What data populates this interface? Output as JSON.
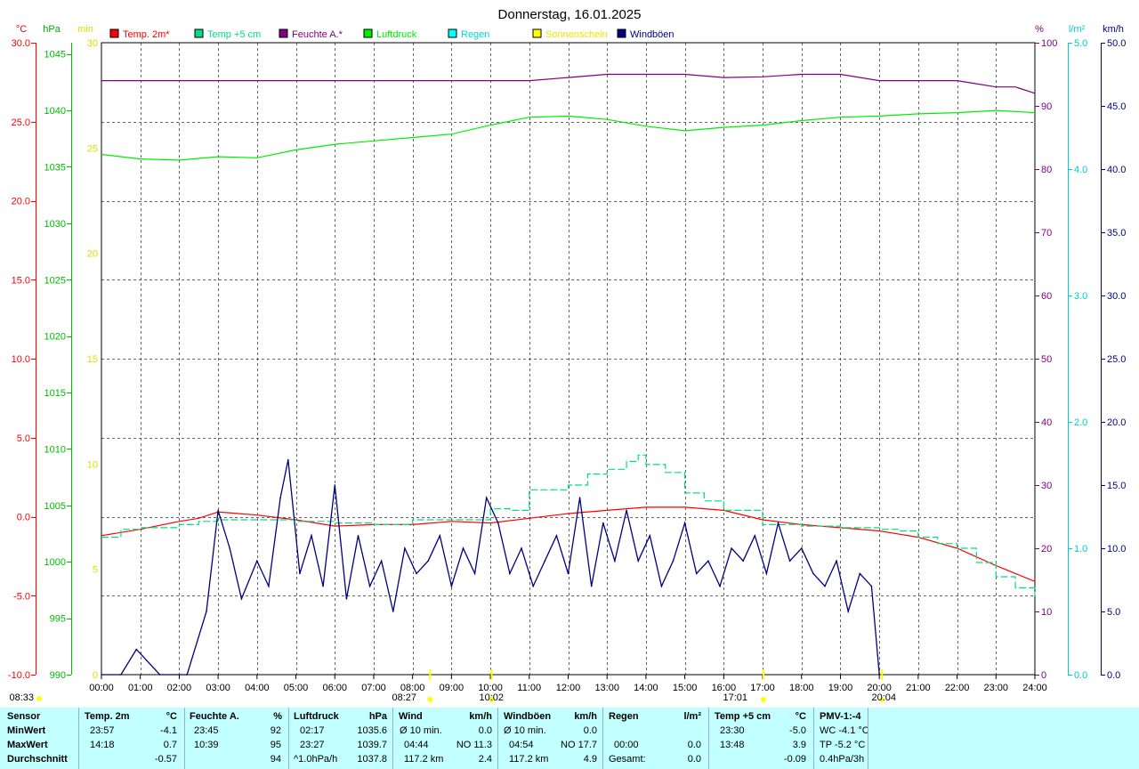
{
  "title": "Donnerstag, 16.01.2025",
  "colors": {
    "temp2m": "#ff0000",
    "temp5cm": "#00e080",
    "humidity": "#800080",
    "pressure": "#00ee00",
    "rain": "#00ffff",
    "sunshine": "#ffff00",
    "gusts": "#000080",
    "footer_bg": "#c2ffff"
  },
  "legend": [
    {
      "label": "Temp. 2m*",
      "color": "#ff0000"
    },
    {
      "label": "Temp +5 cm",
      "color": "#00e080"
    },
    {
      "label": "Feuchte A.*",
      "color": "#800080"
    },
    {
      "label": "Luftdruck",
      "color": "#00ee00"
    },
    {
      "label": "Regen",
      "color": "#00ffff"
    },
    {
      "label": "Sonnenschein",
      "color": "#ffff00"
    },
    {
      "label": "Windböen",
      "color": "#000080"
    }
  ],
  "axis_units": {
    "temp": "°C",
    "pressure": "hPa",
    "sun": "min",
    "humidity": "%",
    "rain": "l/m²",
    "wind": "km/h"
  },
  "chart_data": {
    "type": "line",
    "title": "Donnerstag, 16.01.2025",
    "x_ticks": [
      "00:00",
      "01:00",
      "02:00",
      "03:00",
      "04:00",
      "05:00",
      "06:00",
      "07:00",
      "08:00",
      "09:00",
      "10:00",
      "11:00",
      "12:00",
      "13:00",
      "14:00",
      "15:00",
      "16:00",
      "17:00",
      "18:00",
      "19:00",
      "20:00",
      "21:00",
      "22:00",
      "23:00",
      "24:00"
    ],
    "axes": {
      "temp": {
        "unit": "°C",
        "range": [
          -10,
          30
        ],
        "ticks": [
          "30.0",
          "25.0",
          "20.0",
          "15.0",
          "10.0",
          "5.0",
          "0.0",
          "-5.0",
          "-10.0"
        ]
      },
      "pressure": {
        "unit": "hPa",
        "range": [
          990,
          1046
        ],
        "ticks": [
          "1045",
          "1040",
          "1035",
          "1030",
          "1025",
          "1020",
          "1015",
          "1010",
          "1005",
          "1000",
          "995",
          "990"
        ]
      },
      "sunshine": {
        "unit": "min",
        "range": [
          0,
          30
        ],
        "ticks": [
          "30",
          "25",
          "20",
          "15",
          "10",
          "5",
          "0"
        ]
      },
      "humidity": {
        "unit": "%",
        "range": [
          0,
          100
        ],
        "ticks": [
          "100",
          "90",
          "80",
          "70",
          "60",
          "50",
          "40",
          "30",
          "20",
          "10",
          "0"
        ]
      },
      "rain": {
        "unit": "l/m²",
        "range": [
          0,
          5
        ],
        "ticks": [
          "5.0",
          "4.0",
          "3.0",
          "2.0",
          "1.0",
          "0.0"
        ]
      },
      "wind": {
        "unit": "km/h",
        "range": [
          0,
          50
        ],
        "ticks": [
          "50.0",
          "45.0",
          "40.0",
          "35.0",
          "30.0",
          "25.0",
          "20.0",
          "15.0",
          "10.0",
          "5.0",
          "0.0"
        ]
      }
    },
    "grid": true,
    "series": [
      {
        "name": "Temp. 2m*",
        "axis": "temp",
        "x": [
          0,
          1,
          2,
          2.5,
          3,
          4,
          5,
          6,
          7,
          8,
          9,
          10,
          11,
          12,
          13,
          14,
          15,
          15.5,
          16,
          17,
          18,
          19,
          20,
          21,
          22,
          23,
          24
        ],
        "y": [
          -1.2,
          -0.8,
          -0.3,
          -0.1,
          0.3,
          0.1,
          -0.2,
          -0.6,
          -0.5,
          -0.5,
          -0.3,
          -0.4,
          -0.1,
          0.2,
          0.4,
          0.6,
          0.6,
          0.5,
          0.4,
          -0.2,
          -0.5,
          -0.7,
          -0.9,
          -1.3,
          -2.0,
          -3.1,
          -4.1
        ]
      },
      {
        "name": "Temp +5 cm",
        "axis": "temp",
        "x": [
          0,
          0.5,
          1,
          2,
          2.5,
          3,
          4,
          5,
          6,
          7,
          8,
          9,
          10,
          10.5,
          11,
          12,
          12.5,
          13,
          13.5,
          13.8,
          14,
          14.5,
          15,
          15.5,
          16,
          17,
          18,
          19,
          20,
          20.5,
          21,
          21.5,
          22,
          22.5,
          23,
          23.5,
          24
        ],
        "y": [
          -1.3,
          -0.8,
          -0.7,
          -0.5,
          -0.3,
          -0.2,
          -0.2,
          -0.3,
          -0.4,
          -0.5,
          -0.2,
          -0.2,
          0.5,
          0.4,
          1.7,
          2.0,
          2.7,
          3.0,
          3.5,
          3.9,
          3.3,
          2.8,
          1.5,
          1.0,
          0.4,
          -0.5,
          -0.6,
          -0.7,
          -0.8,
          -0.9,
          -1.3,
          -1.7,
          -2.0,
          -2.9,
          -3.8,
          -4.5,
          -5.0
        ]
      },
      {
        "name": "Feuchte A.*",
        "axis": "humidity",
        "x": [
          0,
          11,
          12,
          13,
          14,
          15,
          16,
          17,
          18,
          19,
          20,
          21,
          22,
          22.5,
          23,
          23.5,
          24
        ],
        "y": [
          94,
          94,
          94.5,
          95,
          95,
          95,
          94.5,
          94.6,
          95,
          95,
          94,
          94,
          94,
          93.5,
          93,
          93,
          92
        ]
      },
      {
        "name": "Luftdruck",
        "axis": "pressure",
        "x": [
          0,
          1,
          2,
          3,
          4,
          5,
          6,
          7,
          8,
          9,
          10,
          11,
          12,
          13,
          14,
          15,
          16,
          17,
          18,
          19,
          20,
          21,
          22,
          23,
          24
        ],
        "y": [
          1036.1,
          1035.7,
          1035.6,
          1035.9,
          1035.8,
          1036.5,
          1037.0,
          1037.3,
          1037.6,
          1037.9,
          1038.7,
          1039.4,
          1039.5,
          1039.2,
          1038.6,
          1038.2,
          1038.5,
          1038.7,
          1039.1,
          1039.4,
          1039.5,
          1039.7,
          1039.8,
          1040.0,
          1039.8
        ]
      },
      {
        "name": "Windböen",
        "axis": "wind",
        "x": [
          0,
          0.5,
          0.9,
          1.5,
          2.2,
          2.7,
          3,
          3.3,
          3.6,
          4,
          4.3,
          4.6,
          4.8,
          5.1,
          5.4,
          5.7,
          6,
          6.3,
          6.6,
          6.9,
          7.2,
          7.5,
          7.8,
          8.1,
          8.4,
          8.7,
          9,
          9.3,
          9.6,
          9.9,
          10.2,
          10.5,
          10.8,
          11.1,
          11.4,
          11.7,
          12,
          12.3,
          12.6,
          12.9,
          13.2,
          13.5,
          13.8,
          14.1,
          14.4,
          14.7,
          15,
          15.3,
          15.6,
          15.9,
          16.2,
          16.5,
          16.8,
          17.1,
          17.4,
          17.7,
          18,
          18.3,
          18.6,
          18.9,
          19.2,
          19.5,
          19.8,
          20
        ],
        "y": [
          0,
          0,
          2,
          0,
          0,
          5,
          13,
          10,
          6,
          9,
          7,
          14,
          17,
          8,
          11,
          7,
          15,
          6,
          11,
          7,
          9,
          5,
          10,
          8,
          9,
          11,
          7,
          10,
          8,
          14,
          12,
          8,
          10,
          7,
          9,
          11,
          8,
          14,
          7,
          12,
          9,
          13,
          9,
          11,
          7,
          9,
          12,
          8,
          9,
          7,
          10,
          9,
          11,
          8,
          12,
          9,
          10,
          8,
          7,
          9,
          5,
          8,
          7,
          0
        ]
      }
    ],
    "markers": [
      {
        "label": "08:33",
        "color": "#ffff00"
      },
      {
        "label": "08:27",
        "color": "#ffff00"
      },
      {
        "label": "10:02",
        "color": "#ffff00"
      },
      {
        "label": "17:01",
        "color": "#ffff00"
      },
      {
        "label": "20:04",
        "color": "#ffff00"
      }
    ]
  },
  "footer": {
    "rowlabels": {
      "sensor": "Sensor",
      "min": "MinWert",
      "max": "MaxWert",
      "avg": "Durchschnitt"
    },
    "temp2m": {
      "title": "Temp. 2m",
      "unit": "°C",
      "min_t": "23:57",
      "min_v": "-4.1",
      "max_t": "14:18",
      "max_v": "0.7",
      "avg": "-0.57"
    },
    "humidity": {
      "title": "Feuchte A.",
      "unit": "%",
      "min_t": "23:45",
      "min_v": "92",
      "max_t": "10:39",
      "max_v": "95",
      "avg": "94"
    },
    "pressure": {
      "title": "Luftdruck",
      "unit": "hPa",
      "min_t": "02:17",
      "min_v": "1035.6",
      "max_t": "23:27",
      "max_v": "1039.7",
      "avg_l": "^1.0hPa/h",
      "avg": "1037.8"
    },
    "wind": {
      "title": "Wind",
      "unit": "km/h",
      "min_l": "Ø 10 min.",
      "min_v": "0.0",
      "max_t": "04:44",
      "max_v": "NO 11.3",
      "avg_l": "117.2 km",
      "avg": "2.4"
    },
    "gusts": {
      "title": "Windböen",
      "unit": "km/h",
      "min_l": "Ø 10 min.",
      "min_v": "0.0",
      "max_t": "04:54",
      "max_v": "NO 17.7",
      "avg_l": "117.2 km",
      "avg": "4.9"
    },
    "rain": {
      "title": "Regen",
      "unit": "l/m²",
      "max_t": "00:00",
      "max_v": "0.0",
      "avg_l": "Gesamt:",
      "avg": "0.0"
    },
    "temp5cm": {
      "title": "Temp +5 cm",
      "unit": "°C",
      "min_t": "23:30",
      "min_v": "-5.0",
      "max_t": "13:48",
      "max_v": "3.9",
      "avg": "-0.09"
    },
    "pmv": {
      "title": "PMV-1:-4",
      "l1": "WC -4.1 °C",
      "l2": "TP -5.2 °C",
      "l3": "0.4hPa/3h"
    }
  }
}
